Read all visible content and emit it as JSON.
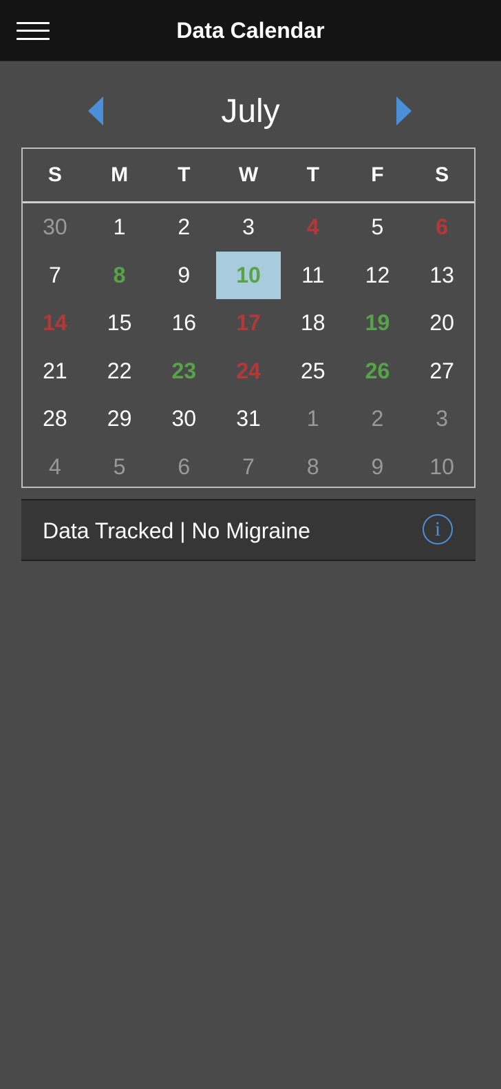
{
  "header": {
    "title": "Data Calendar",
    "menu_icon": "hamburger-menu-icon"
  },
  "month_nav": {
    "title": "July",
    "prev_icon": "triangle-left-icon",
    "next_icon": "triangle-right-icon",
    "arrow_color": "#4a8fd8"
  },
  "calendar": {
    "weekdays": [
      "S",
      "M",
      "T",
      "W",
      "T",
      "F",
      "S"
    ],
    "weeks": [
      [
        {
          "label": "30",
          "status": "muted"
        },
        {
          "label": "1",
          "status": "normal"
        },
        {
          "label": "2",
          "status": "normal"
        },
        {
          "label": "3",
          "status": "normal"
        },
        {
          "label": "4",
          "status": "red"
        },
        {
          "label": "5",
          "status": "normal"
        },
        {
          "label": "6",
          "status": "red"
        }
      ],
      [
        {
          "label": "7",
          "status": "normal"
        },
        {
          "label": "8",
          "status": "green"
        },
        {
          "label": "9",
          "status": "normal"
        },
        {
          "label": "10",
          "status": "green",
          "selected": true
        },
        {
          "label": "11",
          "status": "normal"
        },
        {
          "label": "12",
          "status": "normal"
        },
        {
          "label": "13",
          "status": "normal"
        }
      ],
      [
        {
          "label": "14",
          "status": "red"
        },
        {
          "label": "15",
          "status": "normal"
        },
        {
          "label": "16",
          "status": "normal"
        },
        {
          "label": "17",
          "status": "red"
        },
        {
          "label": "18",
          "status": "normal"
        },
        {
          "label": "19",
          "status": "green"
        },
        {
          "label": "20",
          "status": "normal"
        }
      ],
      [
        {
          "label": "21",
          "status": "normal"
        },
        {
          "label": "22",
          "status": "normal"
        },
        {
          "label": "23",
          "status": "green"
        },
        {
          "label": "24",
          "status": "red"
        },
        {
          "label": "25",
          "status": "normal"
        },
        {
          "label": "26",
          "status": "green"
        },
        {
          "label": "27",
          "status": "normal"
        }
      ],
      [
        {
          "label": "28",
          "status": "normal"
        },
        {
          "label": "29",
          "status": "normal"
        },
        {
          "label": "30",
          "status": "normal"
        },
        {
          "label": "31",
          "status": "normal"
        },
        {
          "label": "1",
          "status": "muted"
        },
        {
          "label": "2",
          "status": "muted"
        },
        {
          "label": "3",
          "status": "muted"
        }
      ],
      [
        {
          "label": "4",
          "status": "muted"
        },
        {
          "label": "5",
          "status": "muted"
        },
        {
          "label": "6",
          "status": "muted"
        },
        {
          "label": "7",
          "status": "muted"
        },
        {
          "label": "8",
          "status": "muted"
        },
        {
          "label": "9",
          "status": "muted"
        },
        {
          "label": "10",
          "status": "muted"
        }
      ]
    ],
    "colors": {
      "red": "#b33838",
      "green": "#58a24a",
      "selected_bg": "#a8ccdc",
      "muted": "#9a9a9a"
    }
  },
  "legend": {
    "text": "Data Tracked | No Migraine",
    "info_icon": "info-circle-icon",
    "info_glyph": "i"
  }
}
